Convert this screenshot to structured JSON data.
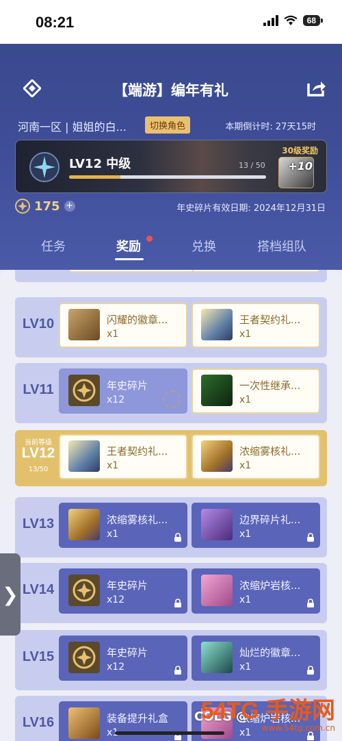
{
  "status_bar": {
    "time": "08:21",
    "battery": "68"
  },
  "header": {
    "title": "【端游】编年有礼",
    "server_role": "河南一区 | 姐姐的白...",
    "switch_role": "切换角色",
    "countdown": "本期倒计时: 27天15时",
    "level": {
      "label": "LV12 中级",
      "current": 13,
      "max": 50,
      "progress_text": "13 / 50",
      "reward_label": "30级奖励",
      "reward_plus": "+10"
    },
    "coin_value": "175",
    "expiry": "年史碎片有效日期: 2024年12月31日",
    "tabs": [
      "任务",
      "奖励",
      "兑换",
      "搭档组队"
    ],
    "active_tab": 1
  },
  "rows": [
    {
      "label": "LV10",
      "cards": [
        {
          "name": "闪耀的徽章...",
          "qty": "x1",
          "state": "light",
          "icon": "badge-chest-icon"
        },
        {
          "name": "王者契约礼...",
          "qty": "x1",
          "state": "light",
          "icon": "contract-gift-icon"
        }
      ]
    },
    {
      "label": "LV11",
      "cards": [
        {
          "name": "年史碎片",
          "qty": "x12",
          "state": "claimed",
          "icon": "coin-icon"
        },
        {
          "name": "一次性继承...",
          "qty": "x1",
          "state": "light",
          "icon": "inherit-icon"
        }
      ]
    },
    {
      "label": "LV12",
      "current": true,
      "tag": "当前等级",
      "progress": "13/50",
      "cards": [
        {
          "name": "王者契约礼...",
          "qty": "x1",
          "state": "light",
          "icon": "contract-gift-icon"
        },
        {
          "name": "浓缩雾核礼...",
          "qty": "x1",
          "state": "light",
          "icon": "mist-core-gift-icon"
        }
      ]
    },
    {
      "label": "LV13",
      "cards": [
        {
          "name": "浓缩雾核礼...",
          "qty": "x1",
          "state": "locked",
          "icon": "mist-core-gift-icon"
        },
        {
          "name": "边界碎片礼...",
          "qty": "x1",
          "state": "locked",
          "icon": "boundary-fragment-icon"
        }
      ]
    },
    {
      "label": "LV14",
      "cards": [
        {
          "name": "年史碎片",
          "qty": "x12",
          "state": "locked",
          "icon": "coin-icon"
        },
        {
          "name": "浓缩炉岩核...",
          "qty": "x1",
          "state": "locked",
          "icon": "furnace-core-icon"
        }
      ]
    },
    {
      "label": "LV15",
      "cards": [
        {
          "name": "年史碎片",
          "qty": "x12",
          "state": "locked",
          "icon": "coin-icon"
        },
        {
          "name": "灿烂的徽章...",
          "qty": "x1",
          "state": "locked",
          "icon": "brilliant-badge-icon"
        }
      ]
    },
    {
      "label": "LV16",
      "cards": [
        {
          "name": "装备提升礼盒",
          "qty": "x1",
          "state": "locked",
          "icon": "equipment-box-icon"
        },
        {
          "name": "浓缩炉岩核...",
          "qty": "x1",
          "state": "locked",
          "icon": "furnace-core-icon"
        }
      ]
    }
  ],
  "watermark": {
    "colg": "COLG @",
    "site": "54TG 手游网",
    "domain": "www.54tg.com.cn"
  },
  "colors": {
    "header": "#3e4d97",
    "current_row": "#e3c06b",
    "row": "#c8cdf0",
    "locked_card": "#5a64b8"
  }
}
